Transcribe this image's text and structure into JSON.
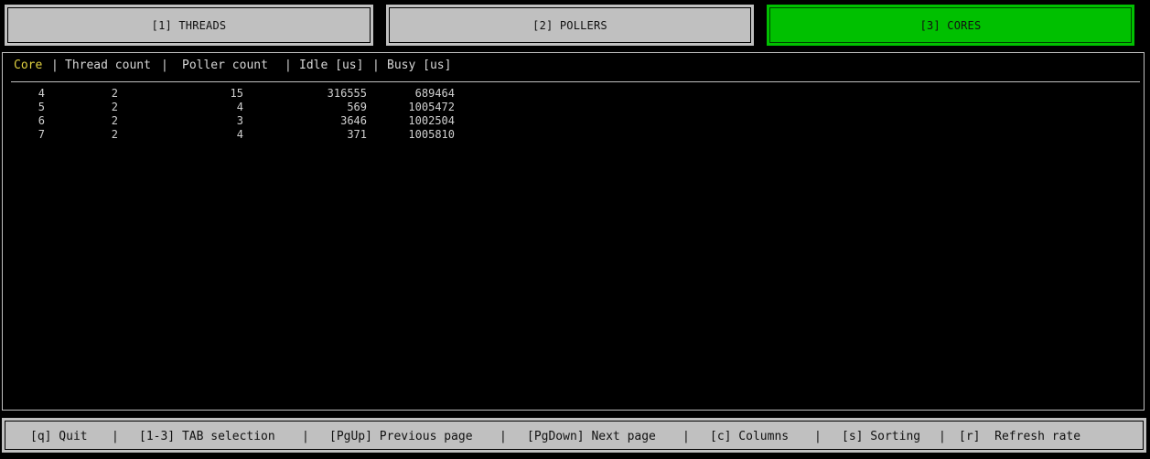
{
  "tabs": [
    {
      "label": "[1] THREADS",
      "active": false
    },
    {
      "label": "[2] POLLERS",
      "active": false
    },
    {
      "label": "[3] CORES",
      "active": true
    }
  ],
  "colors": {
    "active_tab": "#00c000",
    "inactive_tab": "#c0c0c0",
    "sorted_column": "#e0d040",
    "background": "#000000"
  },
  "table": {
    "columns": [
      "Core",
      "Thread count",
      "Poller count",
      "Idle [us]",
      "Busy [us]"
    ],
    "separator": "|",
    "sorted_column": "Core",
    "rows": [
      {
        "core": "4",
        "threads": "2",
        "pollers": "15",
        "idle": "316555",
        "busy": "689464"
      },
      {
        "core": "5",
        "threads": "2",
        "pollers": "4",
        "idle": "569",
        "busy": "1005472"
      },
      {
        "core": "6",
        "threads": "2",
        "pollers": "3",
        "idle": "3646",
        "busy": "1002504"
      },
      {
        "core": "7",
        "threads": "2",
        "pollers": "4",
        "idle": "371",
        "busy": "1005810"
      }
    ]
  },
  "footer": {
    "separator": "|",
    "items": [
      {
        "label": "[q] Quit"
      },
      {
        "label": "[1-3] TAB selection"
      },
      {
        "label": "[PgUp] Previous page"
      },
      {
        "label": "[PgDown] Next page"
      },
      {
        "label": "[c] Columns"
      },
      {
        "label": "[s] Sorting"
      },
      {
        "label": "[r]  Refresh rate"
      }
    ]
  }
}
